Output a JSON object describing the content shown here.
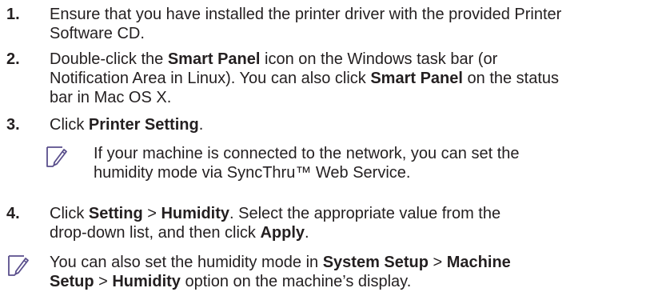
{
  "steps": [
    {
      "number": "1.",
      "line1": "Ensure that you have installed the printer driver with the provided Printer",
      "line2": "Software CD."
    },
    {
      "number": "2.",
      "l1_a": "Double-click the ",
      "l1_b": "Smart Panel",
      "l1_c": " icon on the Windows task bar (or",
      "l2_a": "Notification Area in Linux). You can also click ",
      "l2_b": "Smart Panel",
      "l2_c": " on the status",
      "l3": "bar in Mac OS X."
    },
    {
      "number": "3.",
      "a": "Click ",
      "b": "Printer Setting",
      "c": "."
    },
    {
      "number": "4.",
      "l1_a": "Click ",
      "l1_b": "Setting",
      "l1_c": " > ",
      "l1_d": "Humidity",
      "l1_e": ". Select the appropriate value from the",
      "l2_a": "drop-down list, and then click ",
      "l2_b": "Apply",
      "l2_c": "."
    }
  ],
  "note1": {
    "icon": "note-pencil-icon",
    "line1": "If your machine is connected to the network, you can set the",
    "line2": "humidity mode via SyncThru™ Web Service."
  },
  "note2": {
    "icon": "note-pencil-icon",
    "l1_a": "You can also set the humidity mode in ",
    "l1_b": "System Setup",
    "l1_c": " > ",
    "l1_d": "Machine",
    "l2_a": "Setup",
    "l2_b": " > ",
    "l2_c": "Humidity",
    "l2_d": " option on the machine’s display."
  },
  "colors": {
    "text": "#231f20",
    "icon": "#5a4f8c"
  }
}
